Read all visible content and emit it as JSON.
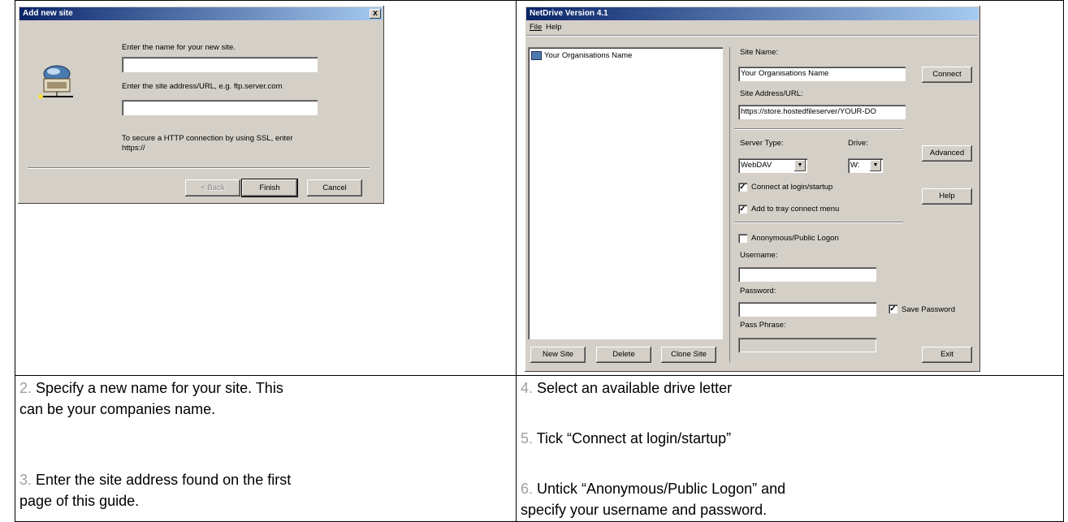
{
  "dialog1": {
    "title": "Add new site",
    "close": "x",
    "prompt_name": "Enter the name for your new site.",
    "name_value": "",
    "prompt_address": "Enter the site address/URL, e.g. ftp.server.com",
    "address_value": "",
    "ssl_note_line1": "To secure a HTTP connection by using SSL, enter",
    "ssl_note_line2": "https://",
    "back_label": "< Back",
    "finish_label": "Finish",
    "cancel_label": "Cancel"
  },
  "netdrive": {
    "title": "NetDrive Version 4.1",
    "menu": [
      "File",
      "Help"
    ],
    "site_list": [
      "Your Organisations Name"
    ],
    "site_name_label": "Site Name:",
    "site_name_value": "Your Organisations Name",
    "connect_label": "Connect",
    "site_address_label": "Site Address/URL:",
    "site_address_value": "https://store.hostedfileserver/YOUR-DO",
    "server_type_label": "Server Type:",
    "server_type_value": "WebDAV",
    "drive_label": "Drive:",
    "drive_value": "W:",
    "advanced_label": "Advanced",
    "connect_login_label": "Connect at login/startup",
    "connect_login_checked": "✓",
    "add_tray_label": "Add to tray connect menu",
    "add_tray_checked": "✓",
    "help_label": "Help",
    "anonymous_label": "Anonymous/Public Logon",
    "username_label": "Username:",
    "username_value": "",
    "password_label": "Password:",
    "password_value": "",
    "save_password_label": "Save Password",
    "save_password_checked": "✓",
    "pass_phrase_label": "Pass Phrase:",
    "new_site_label": "New Site",
    "delete_label": "Delete",
    "clone_site_label": "Clone Site",
    "exit_label": "Exit"
  },
  "captions": {
    "step2_num": "2.",
    "step2_line1": " Specify a new name for your site.  This",
    "step2_line2": "can be your companies name.",
    "step3_num": "3.",
    "step3_line1": " Enter the site address found on the first",
    "step3_line2": "page of this guide.",
    "step4_num": "4.",
    "step4_text": " Select an available drive letter",
    "step5_num": "5.",
    "step5_text": " Tick “Connect at login/startup”",
    "step6_num": "6.",
    "step6_line1": " Untick “Anonymous/Public Logon” and",
    "step6_line2": "specify your username and password."
  }
}
